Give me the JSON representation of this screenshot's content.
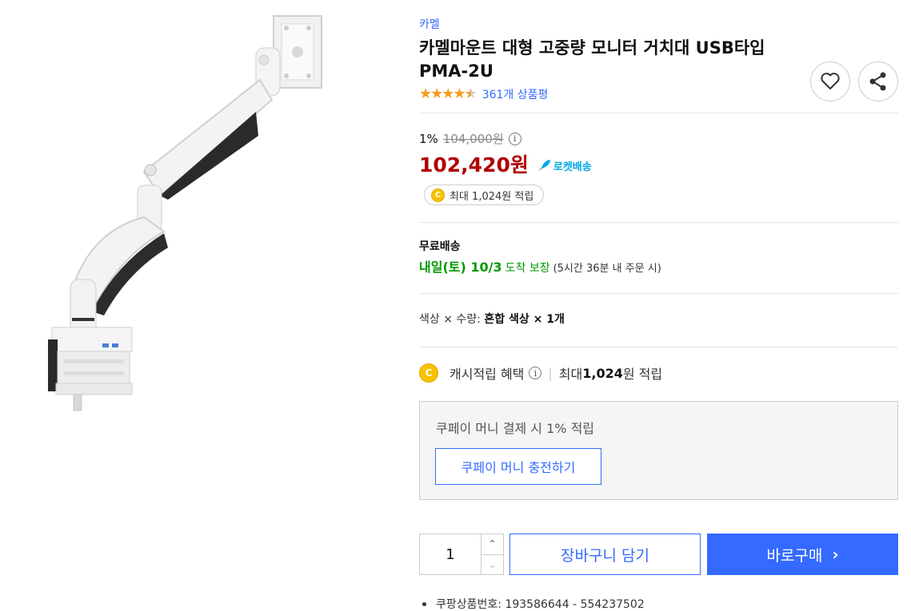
{
  "product": {
    "brand": "카멜",
    "title": "카멜마운트 대형 고중량 모니터 거치대 USB타입 PMA-2U",
    "review_count": "361개 상품평",
    "rating": 4.5
  },
  "icons": {
    "heart": "heart-icon",
    "share": "share-icon",
    "info": "info-icon",
    "coin": "coin-icon",
    "rocket": "rocket-icon"
  },
  "price": {
    "discount_rate": "1%",
    "original_price": "104,000원",
    "info_symbol": "i",
    "sale_price": "102,420원",
    "rocket_label": "로켓배송",
    "reward": "최대 1,024원 적립",
    "coin_symbol": "C"
  },
  "shipping": {
    "label": "무료배송",
    "arrival_date": "내일(토) 10/3",
    "arrival_text": "도착 보장",
    "order_note": "(5시간 36분 내 주문 시)"
  },
  "option": {
    "label": "색상 × 수량: ",
    "value": "혼합 색상 × 1개"
  },
  "cash": {
    "label": "캐시적립 혜택",
    "separator": "|",
    "prefix": "최대 ",
    "amount": "1,024",
    "suffix": "원 적립"
  },
  "coupay": {
    "text": "쿠페이 머니 결제 시 1% 적립",
    "charge_button": "쿠페이 머니 충전하기"
  },
  "purchase": {
    "quantity": "1",
    "up_symbol": "⌃",
    "down_symbol": "⌄",
    "cart_button": "장바구니 담기",
    "buy_button": "바로구매",
    "buy_chevron": "›"
  },
  "meta": {
    "product_number": "쿠팡상품번호: 193586644 - 554237502"
  },
  "colors": {
    "accent": "#346aff",
    "price": "#ae0000",
    "delivery": "#009900",
    "star": "#f59a1d",
    "coin": "#f7c300"
  }
}
